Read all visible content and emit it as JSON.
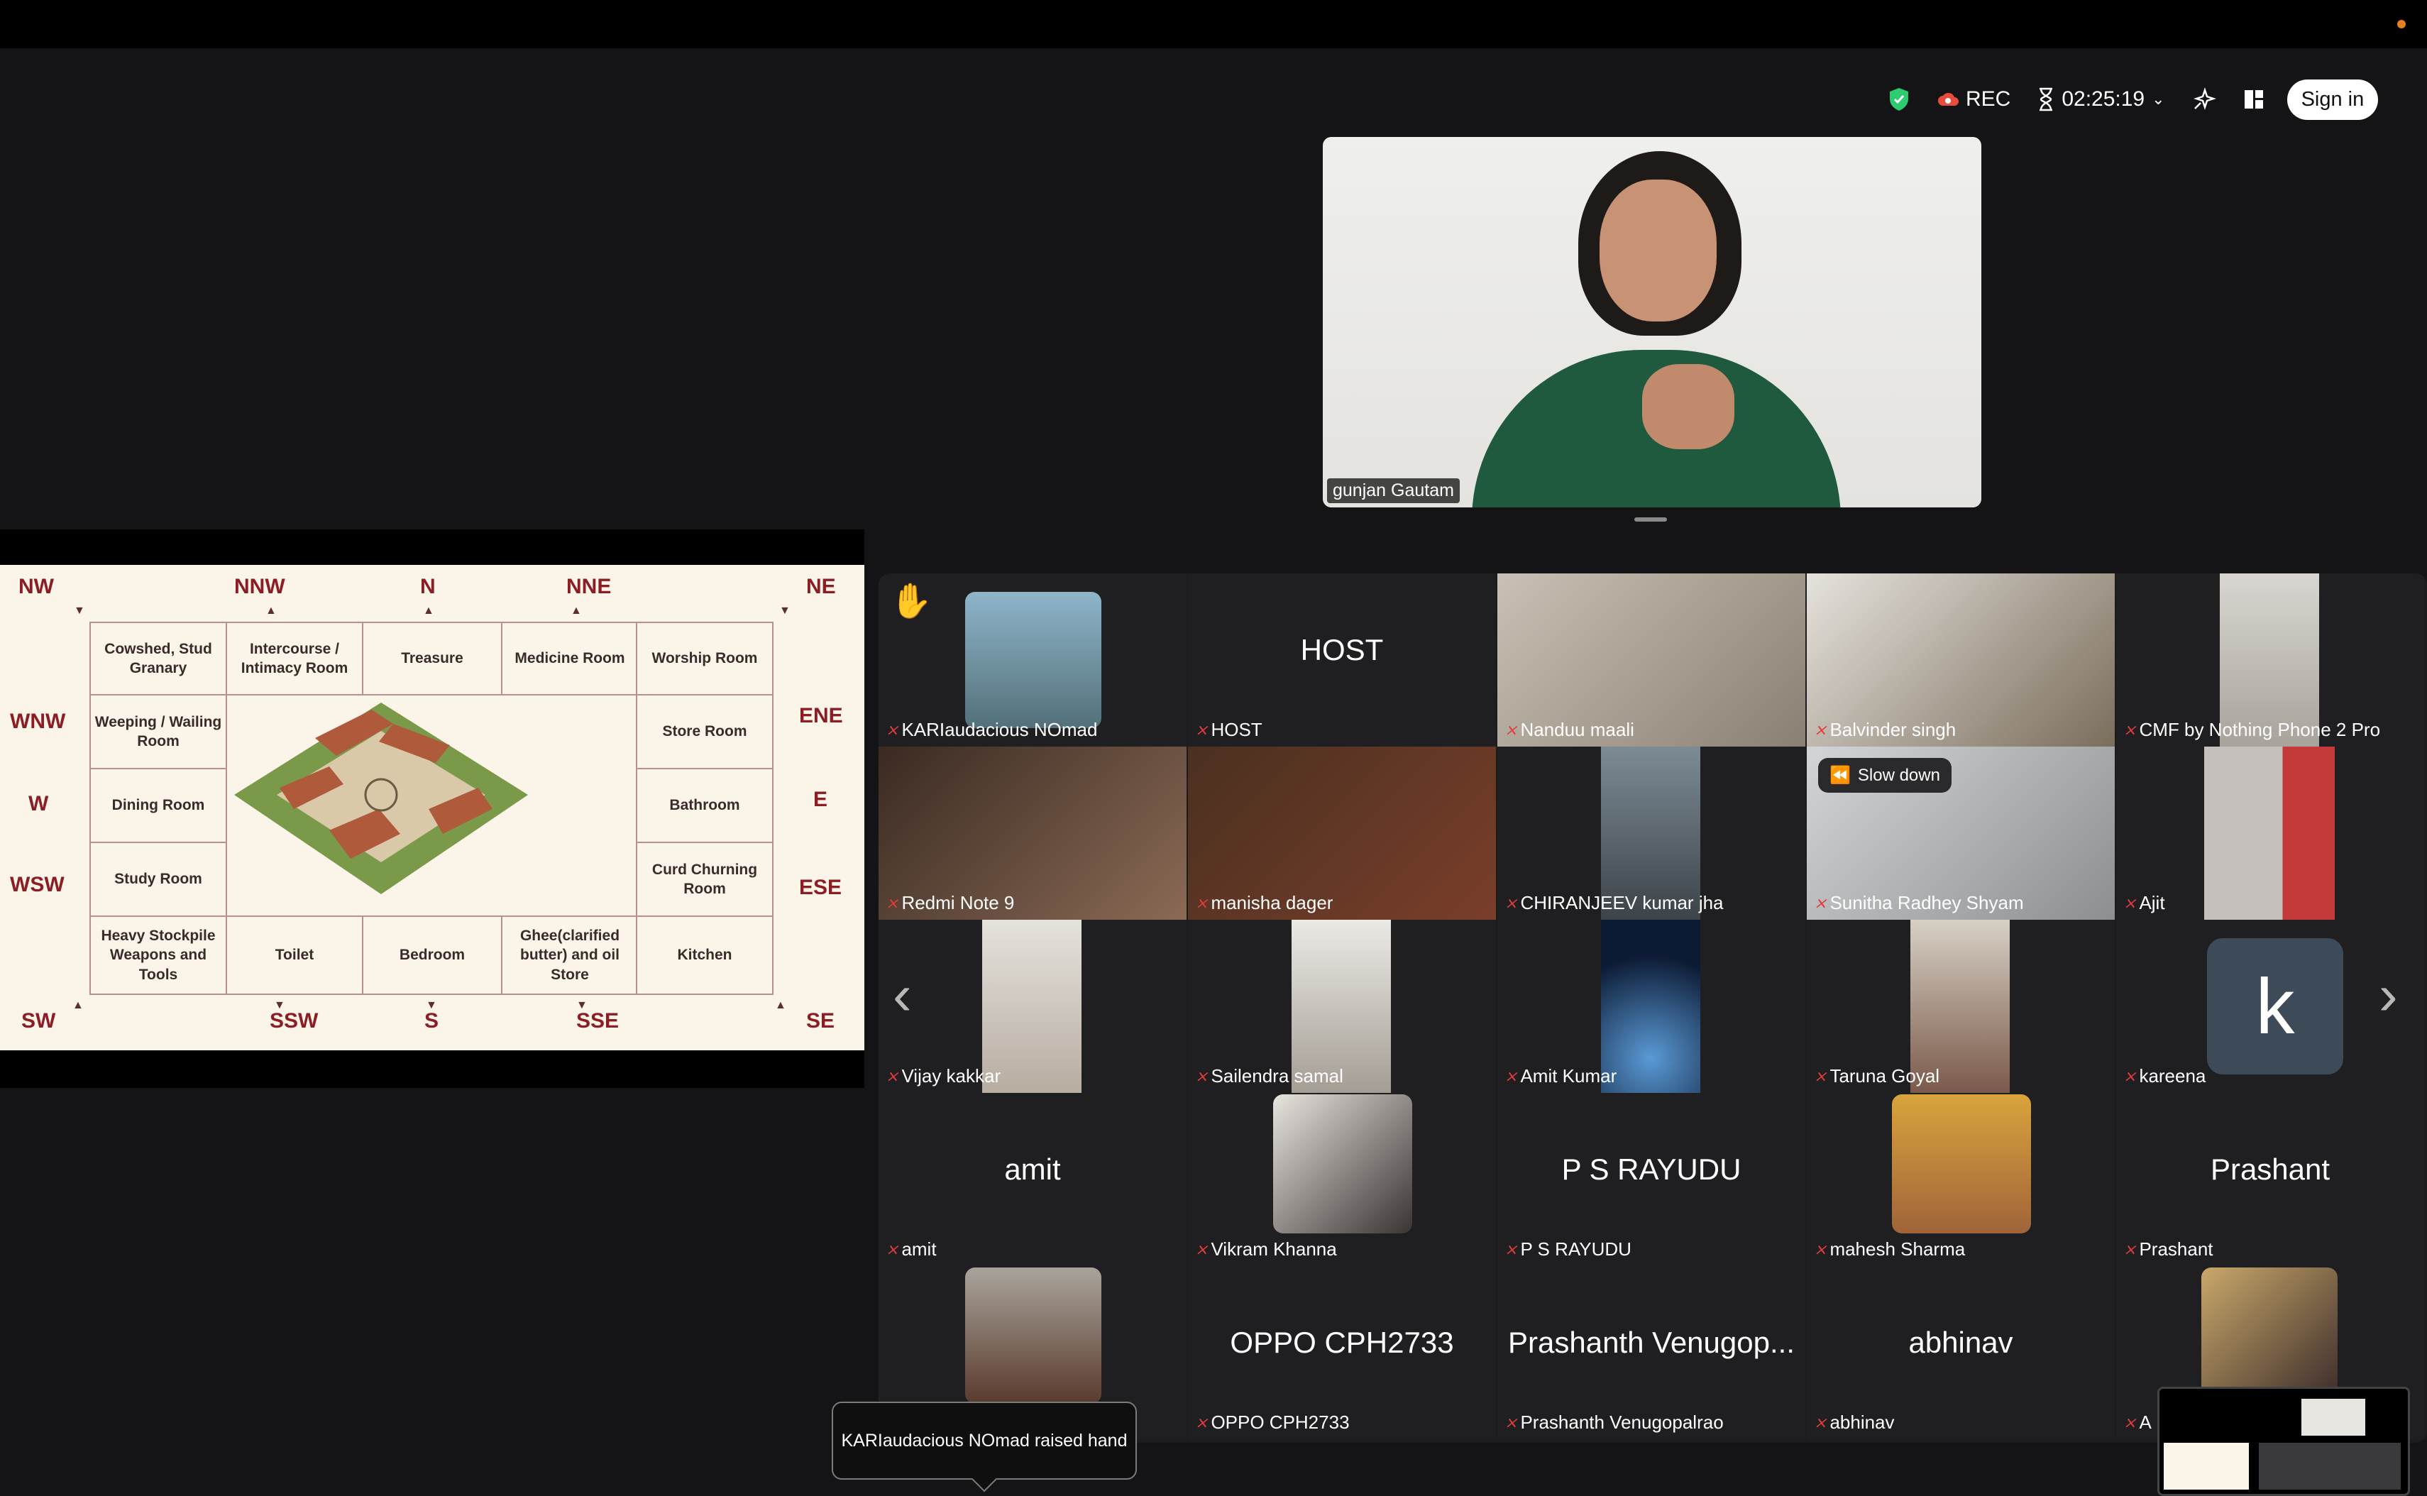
{
  "toolbar": {
    "rec": "REC",
    "timer": "02:25:19",
    "signin": "Sign in"
  },
  "speaker": {
    "name": "gunjan Gautam"
  },
  "slide": {
    "directions": {
      "nw": "NW",
      "nnw": "NNW",
      "n": "N",
      "nne": "NNE",
      "ne": "NE",
      "wnw": "WNW",
      "w": "W",
      "wsw": "WSW",
      "ene": "ENE",
      "e": "E",
      "ese": "ESE",
      "sw": "SW",
      "ssw": "SSW",
      "s": "S",
      "sse": "SSE",
      "se": "SE"
    },
    "rooms": {
      "cowshed": "Cowshed, Stud Granary",
      "intercourse": "Intercourse / Intimacy Room",
      "treasure": "Treasure",
      "medicine": "Medicine Room",
      "worship": "Worship Room",
      "weeping": "Weeping / Wailing Room",
      "store": "Store Room",
      "dining": "Dining Room",
      "bathroom": "Bathroom",
      "study": "Study Room",
      "curd": "Curd Churning Room",
      "heavy": "Heavy Stockpile Weapons and Tools",
      "toilet": "Toilet",
      "bedroom": "Bedroom",
      "ghee": "Ghee(clarified butter) and oil Store",
      "kitchen": "Kitchen"
    }
  },
  "participants": [
    {
      "name": "KARIaudacious NOmad"
    },
    {
      "name": "HOST",
      "center": "HOST"
    },
    {
      "name": "Nanduu maali"
    },
    {
      "name": "Balvinder singh"
    },
    {
      "name": "CMF by Nothing Phone 2 Pro"
    },
    {
      "name": "Redmi Note 9"
    },
    {
      "name": "manisha dager"
    },
    {
      "name": "CHIRANJEEV kumar jha"
    },
    {
      "name": "Sunitha Radhey Shyam",
      "badge": "Slow down"
    },
    {
      "name": "Ajit"
    },
    {
      "name": "Vijay kakkar"
    },
    {
      "name": "Sailendra samal"
    },
    {
      "name": "Amit Kumar"
    },
    {
      "name": "Taruna Goyal"
    },
    {
      "name": "kareena",
      "initial": "k"
    },
    {
      "name": "amit",
      "center": "amit"
    },
    {
      "name": "Vikram Khanna"
    },
    {
      "name": "P S RAYUDU",
      "center": "P S RAYUDU"
    },
    {
      "name": "mahesh Sharma"
    },
    {
      "name": "Prashant",
      "center": "Prashant"
    },
    {
      "name": ""
    },
    {
      "name": "OPPO CPH2733",
      "center": "OPPO CPH2733"
    },
    {
      "name": "Prashanth Venugopalrao",
      "center": "Prashanth Venugop..."
    },
    {
      "name": "abhinav",
      "center": "abhinav"
    },
    {
      "name": "A"
    }
  ],
  "tooltip": "KARIaudacious NOmad raised hand",
  "icons": {
    "shield": "shield-icon",
    "cloud": "cloud-record-icon",
    "hourglass": "hourglass-icon",
    "sparkle": "sparkle-icon",
    "layout": "layout-icon",
    "hand": "raised-hand-icon",
    "muted": "muted-mic-icon"
  },
  "colors": {
    "accent_green": "#2ecc71",
    "muted_red": "#e23b3b",
    "direction_red": "#8b1e24"
  }
}
